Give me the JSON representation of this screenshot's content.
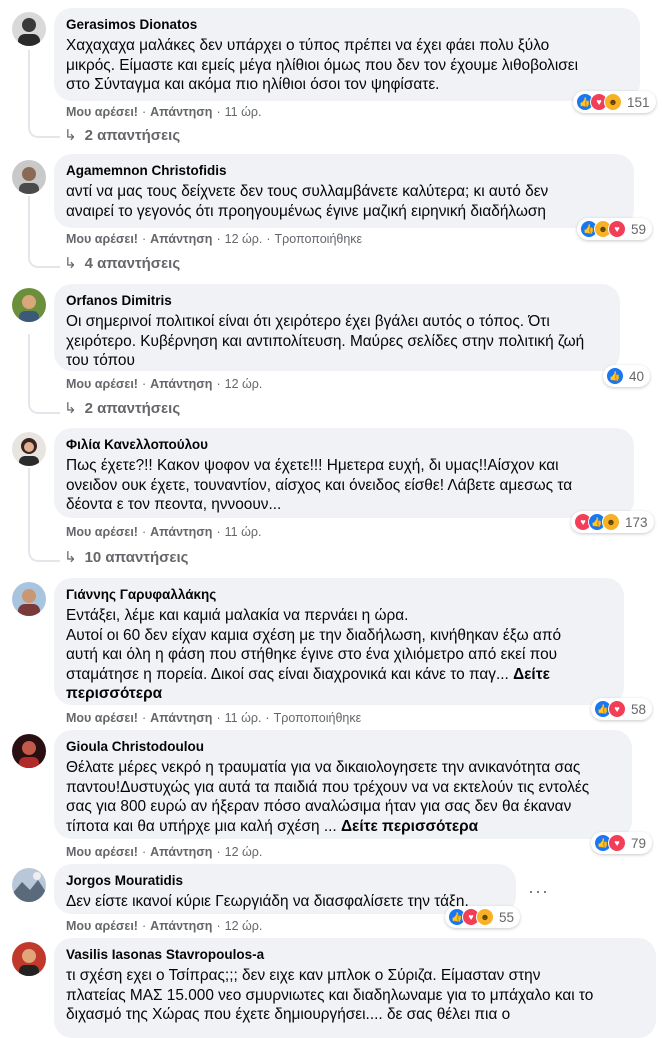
{
  "actions": {
    "like_label": "Μου αρέσει!",
    "reply_label": "Απάντηση",
    "separator": "·"
  },
  "comments": [
    {
      "author": "Gerasimos Dionatos",
      "text": "Χαχαχαχα μαλάκες δεν υπάρχει ο τύπος πρέπει να έχει φάει πολυ ξύλο\nμικρός. Είμαστε και εμείς μέγα ηλίθιοι όμως που δεν τον έχουμε λιθοβολισει\nστο Σύνταγμα και ακόμα πιο ηλίθιοι όσοι τον ψηφίσατε.",
      "time": "11 ώρ.",
      "edited": "",
      "reactions": [
        "like",
        "love",
        "haha"
      ],
      "reaction_count": "151",
      "replies": "2 απαντήσεις"
    },
    {
      "author": "Agamemnon Christofidis",
      "text": "αντί να μας τους δείχνετε δεν τους συλλαμβάνετε καλύτερα; κι αυτό δεν\nαναιρεί το γεγονός ότι προηγουμένως έγινε μαζική ειρηνική διαδήλωση",
      "time": "12 ώρ.",
      "edited": "Τροποποιήθηκε",
      "reactions": [
        "like",
        "haha",
        "love"
      ],
      "reaction_count": "59",
      "replies": "4 απαντήσεις"
    },
    {
      "author": "Orfanos Dimitris",
      "text": "Οι σημερινοί πολιτικοί είναι ότι χειρότερο έχει βγάλει αυτός ο τόπος. Ότι\nχειρότερο. Κυβέρνηση και αντιπολίτευση. Μαύρες σελίδες στην πολιτική ζωή\nτου τόπου",
      "time": "12 ώρ.",
      "edited": "",
      "reactions": [
        "like"
      ],
      "reaction_count": "40",
      "replies": "2 απαντήσεις"
    },
    {
      "author": "Φιλία Κανελλοπούλου",
      "text": "Πως έχετε?!! Κακον ψοφον να έχετε!!! Ημετερα ευχή, δι υμας!!Αίσχον και\nονειδον ουκ έχετε, τουναντίον, αίσχος και όνειδος είσθε! Λάβετε αμεσως τα\nδέοντα ε τον πεοντα, ηννοουν...",
      "time": "11 ώρ.",
      "edited": "",
      "reactions": [
        "love",
        "like",
        "haha"
      ],
      "reaction_count": "173",
      "replies": "10 απαντήσεις"
    },
    {
      "author": "Γιάννης Γαρυφαλλάκης",
      "text": "Εντάξει, λέμε και καμιά μαλακία να περνάει η ώρα.\nΑυτοί οι 60 δεν είχαν καμια σχέση με την διαδήλωση, κινήθηκαν έξω από\nαυτή και όλη η φάση που στήθηκε έγινε στο ένα χιλιόμετρο από εκεί που\nσταμάτησε η πορεία. Δικοί σας είναι διαχρονικά και κάνε το παγ...",
      "see_more": "Δείτε\nπερισσότερα",
      "time": "11 ώρ.",
      "edited": "Τροποποιήθηκε",
      "reactions": [
        "like",
        "love"
      ],
      "reaction_count": "58",
      "replies": ""
    },
    {
      "author": "Gioula Christodoulou",
      "text": "Θέλατε μέρες νεκρό η τραυματία για να δικαιολογησετε την ανικανότητα σας\nπαντου!Δυστυχώς για αυτά τα παιδιά που τρέχουν να να εκτελούν τις εντολές\nσας για 800 ευρώ αν ήξεραν πόσο αναλώσιμα ήταν για σας δεν θα έκαναν\nτίποτα και θα υπήρχε μια καλή σχέση ...",
      "see_more": "Δείτε περισσότερα",
      "time": "12 ώρ.",
      "edited": "",
      "reactions": [
        "like",
        "love"
      ],
      "reaction_count": "79",
      "replies": ""
    },
    {
      "author": "Jorgos Mouratidis",
      "text": "Δεν είστε ικανοί κύριε Γεωργιάδη να διασφαλίσετε την τάξη.",
      "time": "12 ώρ.",
      "edited": "",
      "reactions": [
        "like",
        "love",
        "haha"
      ],
      "reaction_count": "55",
      "replies": "",
      "more_icon": "···"
    },
    {
      "author": "Vasilis Iasonas Stavropoulos-a",
      "text": "τι σχέση εχει ο Τσίπρας;;; δεν ειχε καν μπλοκ ο Σύριζα. Είμασταν στην\nπλατείας ΜΑΣ 15.000 νεο σμυρνιωτες και διαδηλωναμε για το μπάχαλο και το\nδιχασμό της Χώρας που έχετε δημιουργήσει.... δε σας θέλει πια ο",
      "time": "",
      "edited": "",
      "reactions": [],
      "reaction_count": "",
      "replies": ""
    }
  ],
  "colors": {
    "bubble": "#f0f2f5",
    "meta": "#65676b",
    "text": "#050505",
    "like": "#1877f2",
    "love": "#f33e58",
    "haha": "#f7b125"
  }
}
